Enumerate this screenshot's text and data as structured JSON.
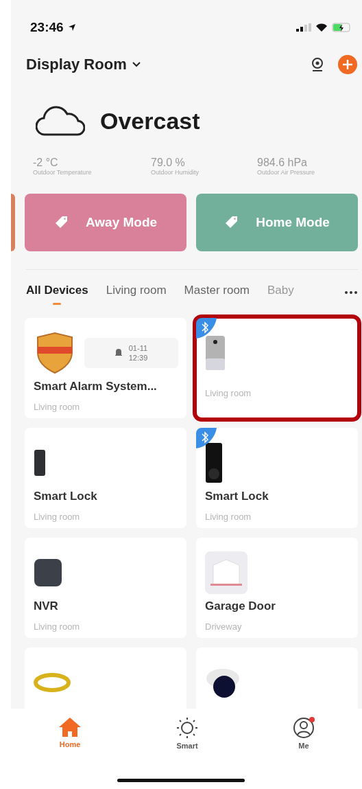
{
  "status_bar": {
    "time": "23:46"
  },
  "header": {
    "home_name": "Display Room"
  },
  "weather": {
    "condition": "Overcast",
    "stats": [
      {
        "value": "-2 °C",
        "label": "Outdoor Temperature"
      },
      {
        "value": "79.0 %",
        "label": "Outdoor Humidity"
      },
      {
        "value": "984.6 hPa",
        "label": "Outdoor Air Pressure"
      }
    ]
  },
  "scenes": [
    {
      "label": "Away Mode",
      "color": "#d9809b"
    },
    {
      "label": "Home Mode",
      "color": "#72b09c"
    }
  ],
  "room_tabs": [
    {
      "label": "All Devices",
      "selected": true
    },
    {
      "label": "Living room",
      "selected": false
    },
    {
      "label": "Master room",
      "selected": false
    },
    {
      "label": "Baby",
      "selected": false
    }
  ],
  "devices": [
    {
      "kind": "alarm",
      "name": "Smart Alarm System...",
      "room": "Living room",
      "bluetooth": false,
      "highlighted": false,
      "alert": {
        "date": "01-11",
        "time": "12:39"
      }
    },
    {
      "kind": "sensor",
      "room": "Living room",
      "bluetooth": true,
      "highlighted": true
    },
    {
      "kind": "lock_small",
      "name": "Smart Lock",
      "room": "Living room",
      "bluetooth": false,
      "highlighted": false
    },
    {
      "kind": "lock_black",
      "name": "Smart Lock",
      "room": "Living room",
      "bluetooth": true,
      "highlighted": false
    },
    {
      "kind": "nvr",
      "name": "NVR",
      "room": "Living room",
      "bluetooth": false,
      "highlighted": false
    },
    {
      "kind": "garage",
      "name": "Garage Door",
      "room": "Driveway",
      "bluetooth": false,
      "highlighted": false
    },
    {
      "kind": "cable",
      "bluetooth": false,
      "highlighted": false
    },
    {
      "kind": "camera",
      "bluetooth": false,
      "highlighted": false
    }
  ],
  "bottom_nav": [
    {
      "kind": "home",
      "label": "Home",
      "selected": true
    },
    {
      "kind": "smart",
      "label": "Smart",
      "selected": false
    },
    {
      "kind": "me",
      "label": "Me",
      "selected": false,
      "notification": true
    }
  ]
}
